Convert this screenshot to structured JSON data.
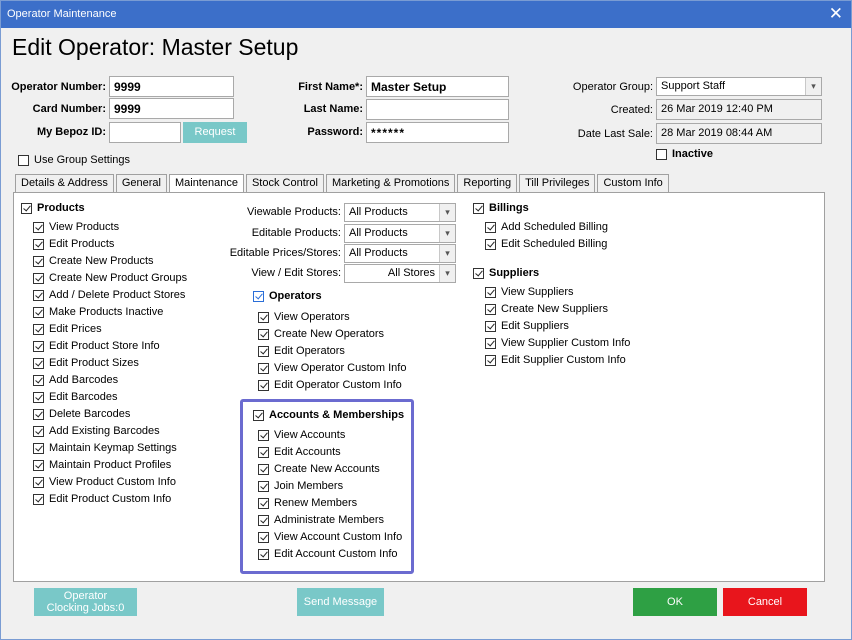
{
  "window": {
    "title": "Operator Maintenance"
  },
  "heading": "Edit Operator: Master Setup",
  "form": {
    "operator_number": {
      "label": "Operator Number:",
      "value": "9999"
    },
    "card_number": {
      "label": "Card Number:",
      "value": "9999"
    },
    "bepoz_id": {
      "label": "My Bepoz ID:",
      "value": "",
      "button": "Request"
    },
    "first_name": {
      "label": "First Name*:",
      "value": "Master Setup"
    },
    "last_name": {
      "label": "Last Name:",
      "value": ""
    },
    "password": {
      "label": "Password:",
      "value": "******"
    },
    "operator_group": {
      "label": "Operator Group:",
      "value": "Support Staff"
    },
    "created": {
      "label": "Created:",
      "value": "26 Mar 2019 12:40 PM"
    },
    "date_last_sale": {
      "label": "Date Last Sale:",
      "value": "28 Mar 2019 08:44 AM"
    },
    "inactive": {
      "label": "Inactive",
      "checked": false
    },
    "use_group_settings": {
      "label": "Use Group Settings",
      "checked": false
    }
  },
  "tabs": [
    {
      "label": "Details & Address"
    },
    {
      "label": "General"
    },
    {
      "label": "Maintenance",
      "active": true
    },
    {
      "label": "Stock Control"
    },
    {
      "label": "Marketing & Promotions"
    },
    {
      "label": "Reporting"
    },
    {
      "label": "Till Privileges"
    },
    {
      "label": "Custom Info"
    }
  ],
  "products": {
    "title": "Products",
    "items": [
      "View Products",
      "Edit Products",
      "Create New Products",
      "Create New Product Groups",
      "Add / Delete Product Stores",
      "Make Products Inactive",
      "Edit Prices",
      "Edit Product Store Info",
      "Edit Product Sizes",
      "Add Barcodes",
      "Edit Barcodes",
      "Delete Barcodes",
      "Add Existing Barcodes",
      "Maintain Keymap Settings",
      "Maintain Product Profiles",
      "View Product Custom Info",
      "Edit Product Custom Info"
    ]
  },
  "dropdowns": [
    {
      "label": "Viewable Products:",
      "value": "All Products"
    },
    {
      "label": "Editable Products:",
      "value": "All Products"
    },
    {
      "label": "Editable Prices/Stores:",
      "value": "All Products"
    },
    {
      "label": "View / Edit Stores:",
      "value": "All Stores"
    }
  ],
  "operators": {
    "title": "Operators",
    "items": [
      "View Operators",
      "Create New Operators",
      "Edit Operators",
      "View Operator Custom Info",
      "Edit Operator Custom Info"
    ]
  },
  "accounts": {
    "title": "Accounts & Memberships",
    "items": [
      "View Accounts",
      "Edit Accounts",
      "Create New Accounts",
      "Join Members",
      "Renew Members",
      "Administrate Members",
      "View Account Custom Info",
      "Edit Account Custom Info"
    ]
  },
  "billings": {
    "title": "Billings",
    "items": [
      "Add Scheduled Billing",
      "Edit Scheduled Billing"
    ]
  },
  "suppliers": {
    "title": "Suppliers",
    "items": [
      "View Suppliers",
      "Create New Suppliers",
      "Edit Suppliers",
      "View Supplier Custom Info",
      "Edit Supplier Custom Info"
    ]
  },
  "footer": {
    "clocking_line1": "Operator",
    "clocking_line2": "Clocking Jobs:0",
    "send_message": "Send Message",
    "ok": "OK",
    "cancel": "Cancel"
  },
  "colors": {
    "titlebar": "#3c6fc9",
    "teal_button": "#79c8c8",
    "ok": "#2ea044",
    "cancel": "#e8151c",
    "highlight": "#6b6bd0"
  }
}
